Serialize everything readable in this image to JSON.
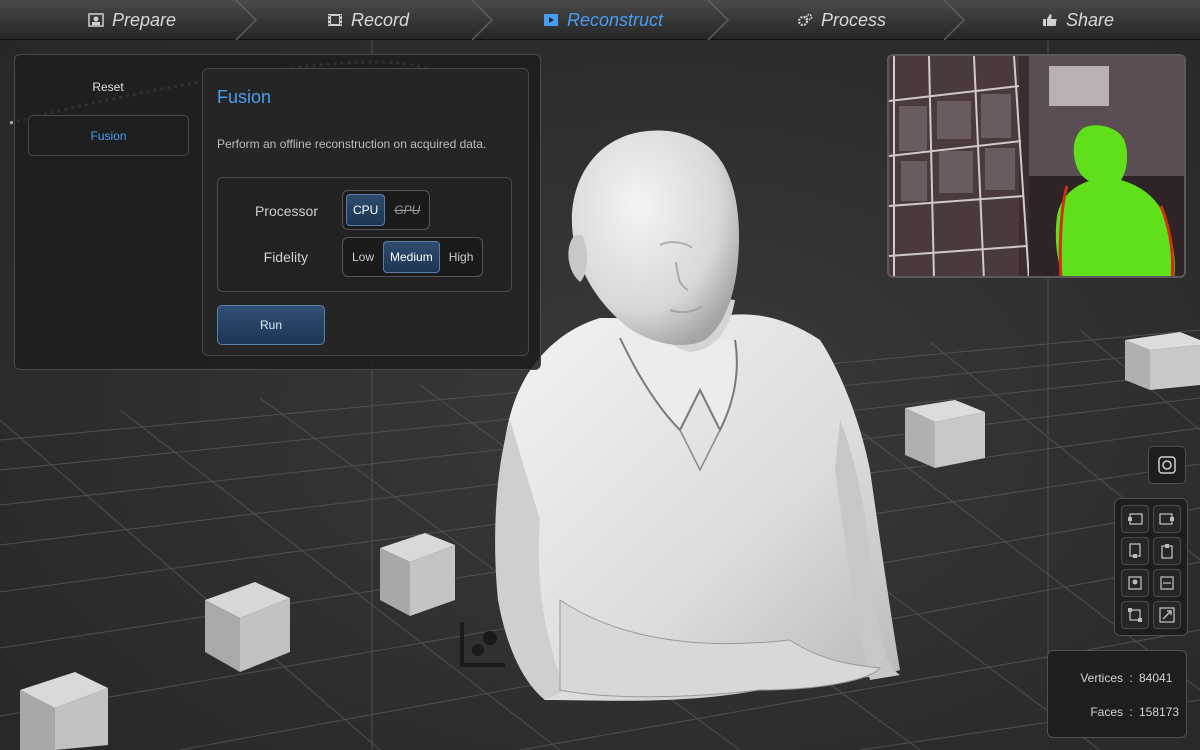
{
  "workflow": {
    "steps": [
      {
        "label": "Prepare",
        "icon": "prepare-icon",
        "active": false
      },
      {
        "label": "Record",
        "icon": "film-icon",
        "active": false
      },
      {
        "label": "Reconstruct",
        "icon": "reconstruct-icon",
        "active": true
      },
      {
        "label": "Process",
        "icon": "gears-icon",
        "active": false
      },
      {
        "label": "Share",
        "icon": "thumbs-up-icon",
        "active": false
      }
    ]
  },
  "sidebar": {
    "items": [
      {
        "label": "Reset",
        "selected": false
      },
      {
        "label": "Fusion",
        "selected": true
      }
    ]
  },
  "fusion": {
    "title": "Fusion",
    "description": "Perform an offline reconstruction on acquired data.",
    "processor": {
      "label": "Processor",
      "options": [
        "CPU",
        "GPU"
      ],
      "selected": "CPU",
      "disabled": [
        "GPU"
      ]
    },
    "fidelity": {
      "label": "Fidelity",
      "options": [
        "Low",
        "Medium",
        "High"
      ],
      "selected": "Medium"
    },
    "run_label": "Run"
  },
  "stats": {
    "vertices_label": "Vertices",
    "vertices": "84041",
    "faces_label": "Faces",
    "faces": "158173",
    "separator": ":"
  },
  "tools": [
    "camera-reset-icon",
    "view-left-icon",
    "view-right-icon",
    "view-bottom-icon",
    "view-top-icon",
    "view-front-icon",
    "view-back-icon",
    "fit-view-icon",
    "fullscreen-icon"
  ],
  "colors": {
    "accent": "#4a9cf0",
    "mask": "#5fe01a"
  }
}
